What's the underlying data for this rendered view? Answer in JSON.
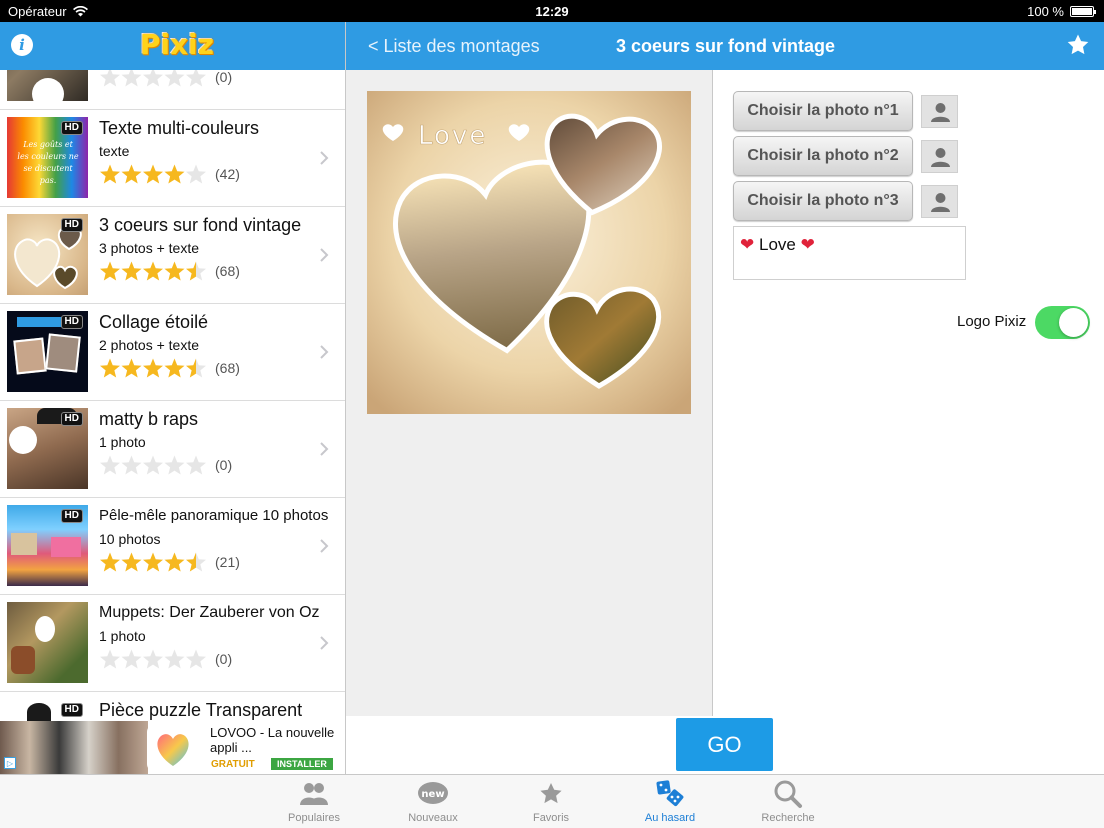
{
  "status_bar": {
    "carrier": "Opérateur",
    "time": "12:29",
    "battery": "100 %"
  },
  "sidebar": {
    "logo": "Pixiz",
    "items": [
      {
        "title": "",
        "subtitle": "",
        "count": "(0)",
        "rating": 0,
        "hd": false
      },
      {
        "title": "Texte multi-couleurs",
        "subtitle": "texte",
        "count": "(42)",
        "rating": 4,
        "hd": true
      },
      {
        "title": "3 coeurs sur fond vintage",
        "subtitle": "3 photos + texte",
        "count": "(68)",
        "rating": 4.5,
        "hd": true
      },
      {
        "title": "Collage étoilé",
        "subtitle": "2 photos + texte",
        "count": "(68)",
        "rating": 4.5,
        "hd": true
      },
      {
        "title": "matty b raps",
        "subtitle": "1 photo",
        "count": "(0)",
        "rating": 0,
        "hd": true
      },
      {
        "title": "Pêle-mêle panoramique 10 photos",
        "subtitle": "10 photos",
        "count": "(21)",
        "rating": 4.5,
        "hd": true
      },
      {
        "title": "Muppets: Der Zauberer von Oz",
        "subtitle": "1 photo",
        "count": "(0)",
        "rating": 0,
        "hd": false
      },
      {
        "title": "Pièce puzzle Transparent",
        "subtitle": "",
        "count": "",
        "rating": 0,
        "hd": true
      }
    ]
  },
  "ad": {
    "title": "LOVOO - La nouvelle appli ...",
    "free_label": "GRATUIT",
    "install_label": "INSTALLER"
  },
  "navbar": {
    "back_label": "< Liste des montages",
    "title": "3 coeurs sur fond vintage"
  },
  "montage": {
    "text": "Love"
  },
  "editor": {
    "photo_buttons": [
      "Choisir la photo n°1",
      "Choisir la photo n°2",
      "Choisir la photo n°3"
    ],
    "text_value": "Love",
    "logo_toggle_label": "Logo Pixiz",
    "logo_toggle_on": true,
    "go_label": "GO"
  },
  "tabbar": {
    "tabs": [
      {
        "label": "Populaires",
        "icon": "people-icon",
        "active": false
      },
      {
        "label": "Nouveaux",
        "icon": "new-badge-icon",
        "active": false
      },
      {
        "label": "Favoris",
        "icon": "star-icon",
        "active": false
      },
      {
        "label": "Au hasard",
        "icon": "dice-icon",
        "active": true
      },
      {
        "label": "Recherche",
        "icon": "magnifier-icon",
        "active": false
      }
    ]
  },
  "colors": {
    "brand_blue": "#2f9be3",
    "go_blue": "#1d9be6",
    "star_gold": "#f6b81f",
    "toggle_green": "#4cd964",
    "active_tab": "#1d7fd6"
  }
}
